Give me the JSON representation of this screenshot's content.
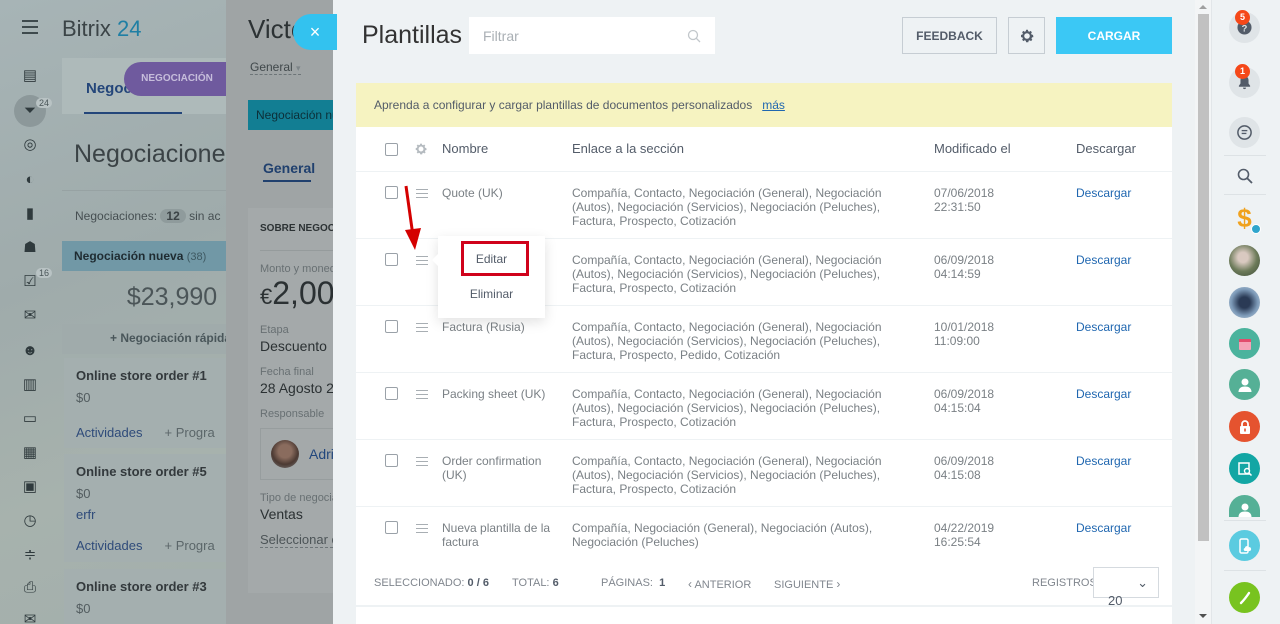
{
  "background_app": {
    "logo_text": "Bitrix",
    "logo_number": "24",
    "left_menu_badges": {
      "crm": "24",
      "tasks": "16"
    },
    "left_menu_icons": [
      "menu-icon",
      "feed-icon",
      "crm-funnel-icon",
      "target-icon",
      "moon-icon",
      "chart-icon",
      "robot-icon",
      "tasks-icon",
      "chat-icon",
      "team-icon",
      "knowledge-book-icon",
      "drive-icon",
      "calendar-icon",
      "contact-card-icon",
      "clock-icon",
      "settings-sliders-icon",
      "printer-icon",
      "mail-icon"
    ],
    "tab_label": "Negociaciones",
    "tab_pill": "NEGOCIACIÓN",
    "page_title": "Negociaciones",
    "count_label": "Negociaciones:",
    "count_value": "12",
    "count_suffix": "sin ac",
    "stage_name": "Negociación nueva",
    "stage_count": "(38)",
    "stage_sum": "$23,990",
    "quick_add": "+ Negociación rápida",
    "cards": [
      {
        "title": "Online store order #1",
        "amount": "$0",
        "activities": "Actividades",
        "plan": "+ Progra"
      },
      {
        "title": "Online store order #5",
        "amount": "$0",
        "link": "erfr",
        "activities": "Actividades",
        "plan": "+ Progra"
      },
      {
        "title": "Online store order #3",
        "amount": "$0"
      }
    ]
  },
  "deal_panel": {
    "title": "Victo",
    "category": "General",
    "stage": "Negociación nueva",
    "tab": "General",
    "section_title": "SOBRE NEGOCIACIÓN",
    "amount_label": "Monto y moneda",
    "amount_currency": "€",
    "amount_value": "2,00",
    "stage_label": "Etapa",
    "stage_value": "Descuento",
    "close_date_label": "Fecha final",
    "close_date_value": "28 Agosto 2",
    "responsible_label": "Responsable",
    "responsible_name": "Adri",
    "type_label": "Tipo de negociación",
    "type_value": "Ventas",
    "select_link": "Seleccionar c"
  },
  "close_button": "×",
  "slider": {
    "title": "Plantillas",
    "filter_placeholder": "Filtrar",
    "feedback_label": "FEEDBACK",
    "upload_label": "CARGAR",
    "notice_text": "Aprenda a configurar y cargar plantillas de documentos personalizados",
    "notice_link": "más",
    "columns": {
      "name": "Nombre",
      "section": "Enlace a la sección",
      "modified": "Modificado el",
      "download": "Descargar"
    },
    "rows": [
      {
        "name": "Quote (UK)",
        "section": "Compañía, Contacto, Negociación (General), Negociación (Autos), Negociación (Servicios), Negociación (Peluches), Factura, Prospecto, Cotización",
        "date": "07/06/2018",
        "time": "22:31:50",
        "download": "Descargar"
      },
      {
        "name": "",
        "section": "Compañía, Contacto, Negociación (General), Negociación (Autos), Negociación (Servicios), Negociación (Peluches), Factura, Prospecto, Cotización",
        "date": "06/09/2018",
        "time": "04:14:59",
        "download": "Descargar"
      },
      {
        "name": "Factura (Rusia)",
        "section": "Compañía, Contacto, Negociación (General), Negociación (Autos), Negociación (Servicios), Negociación (Peluches), Factura, Prospecto, Pedido, Cotización",
        "date": "10/01/2018",
        "time": "11:09:00",
        "download": "Descargar"
      },
      {
        "name": "Packing sheet (UK)",
        "section": "Compañía, Contacto, Negociación (General), Negociación (Autos), Negociación (Servicios), Negociación (Peluches), Factura, Prospecto, Cotización",
        "date": "06/09/2018",
        "time": "04:15:04",
        "download": "Descargar"
      },
      {
        "name": "Order confirmation (UK)",
        "section": "Compañía, Contacto, Negociación (General), Negociación (Autos), Negociación (Servicios), Negociación (Peluches), Factura, Prospecto, Cotización",
        "date": "06/09/2018",
        "time": "04:15:08",
        "download": "Descargar"
      },
      {
        "name": "Nueva plantilla de la factura",
        "section": "Compañía, Negociación (General), Negociación (Autos), Negociación (Peluches)",
        "date": "04/22/2019",
        "time": "16:25:54",
        "download": "Descargar"
      }
    ],
    "context_menu": {
      "edit": "Editar",
      "delete": "Eliminar"
    },
    "footer": {
      "selected_label": "SELECCIONADO:",
      "selected_value": "0 / 6",
      "total_label": "TOTAL:",
      "total_value": "6",
      "pages_label": "PÁGINAS:",
      "pages_value": "1",
      "prev": "ANTERIOR",
      "next": "SIGUIENTE",
      "records_label": "REGISTROS:",
      "records_value": "20"
    }
  },
  "right_rail": {
    "help_badge": "5",
    "notifications_badge": "1",
    "colors": {
      "green": "#55b096",
      "red": "#e5532f",
      "teal": "#12a6a4",
      "light_blue": "#5bcbe0",
      "phone_green": "#78c31f",
      "accent_blue": "#3bc8f5"
    }
  }
}
